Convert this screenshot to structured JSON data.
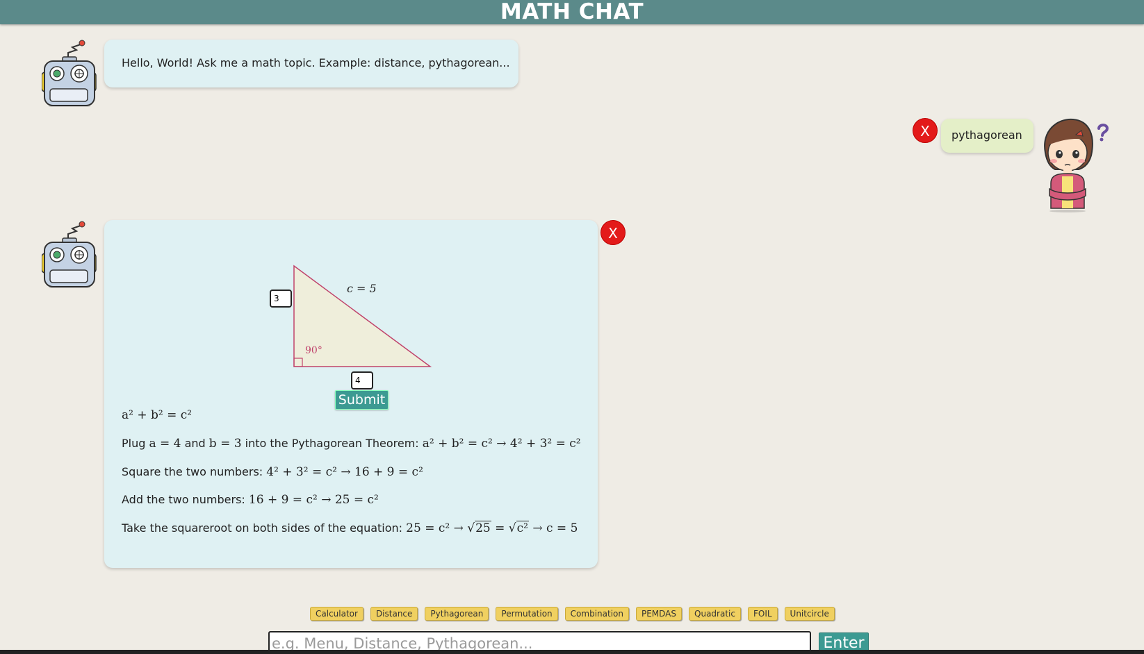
{
  "header": {
    "title": "MATH CHAT"
  },
  "messages": {
    "greeting": "Hello, World! Ask me a math topic. Example: distance, pythagorean...",
    "user_query": "pythagorean"
  },
  "close_label": "X",
  "lesson": {
    "hypotenuse_label": "c = 5",
    "angle_label": "90°",
    "side_a_value": "3",
    "side_b_value": "4",
    "submit_label": "Submit",
    "formula": "a² + b² = c²",
    "steps": {
      "plug": {
        "text1": "Plug ",
        "math1": "a = 4",
        "text2": " and ",
        "math2": "b = 3",
        "text3": " into the Pythagorean Theorem: ",
        "math3": "a² + b² = c² → 4² + 3² = c²"
      },
      "square": {
        "text": "Square the two numbers: ",
        "math": "4² + 3² = c² → 16 + 9 = c²"
      },
      "add": {
        "text": "Add the two numbers: ",
        "math": "16 + 9 = c² → 25 = c²"
      },
      "sqrt": {
        "text": "Take the squareroot on both sides of the equation: ",
        "math_before": "25 = c² → ",
        "radicand1": "25",
        "radicand2": "c²",
        "math_after": "→ c = 5"
      }
    }
  },
  "quick_menu": [
    "Calculator",
    "Distance",
    "Pythagorean",
    "Permutation",
    "Combination",
    "PEMDAS",
    "Quadratic",
    "FOIL",
    "Unitcircle"
  ],
  "input": {
    "placeholder": "e.g. Menu, Distance, Pythagorean...",
    "enter_label": "Enter"
  },
  "colors": {
    "header_bg": "#5b8a8a",
    "page_bg": "#efece5",
    "bot_bubble": "#dff1f3",
    "user_bubble": "#e4efc8",
    "close": "#e31a1a",
    "accent_button": "#3c9a92",
    "menu_button": "#f0d060",
    "triangle_stroke": "#c0436b",
    "triangle_fill": "#efeedb"
  },
  "icons": {
    "bot": "robot-avatar",
    "user": "girl-thinking-avatar",
    "question": "question-mark-icon"
  }
}
